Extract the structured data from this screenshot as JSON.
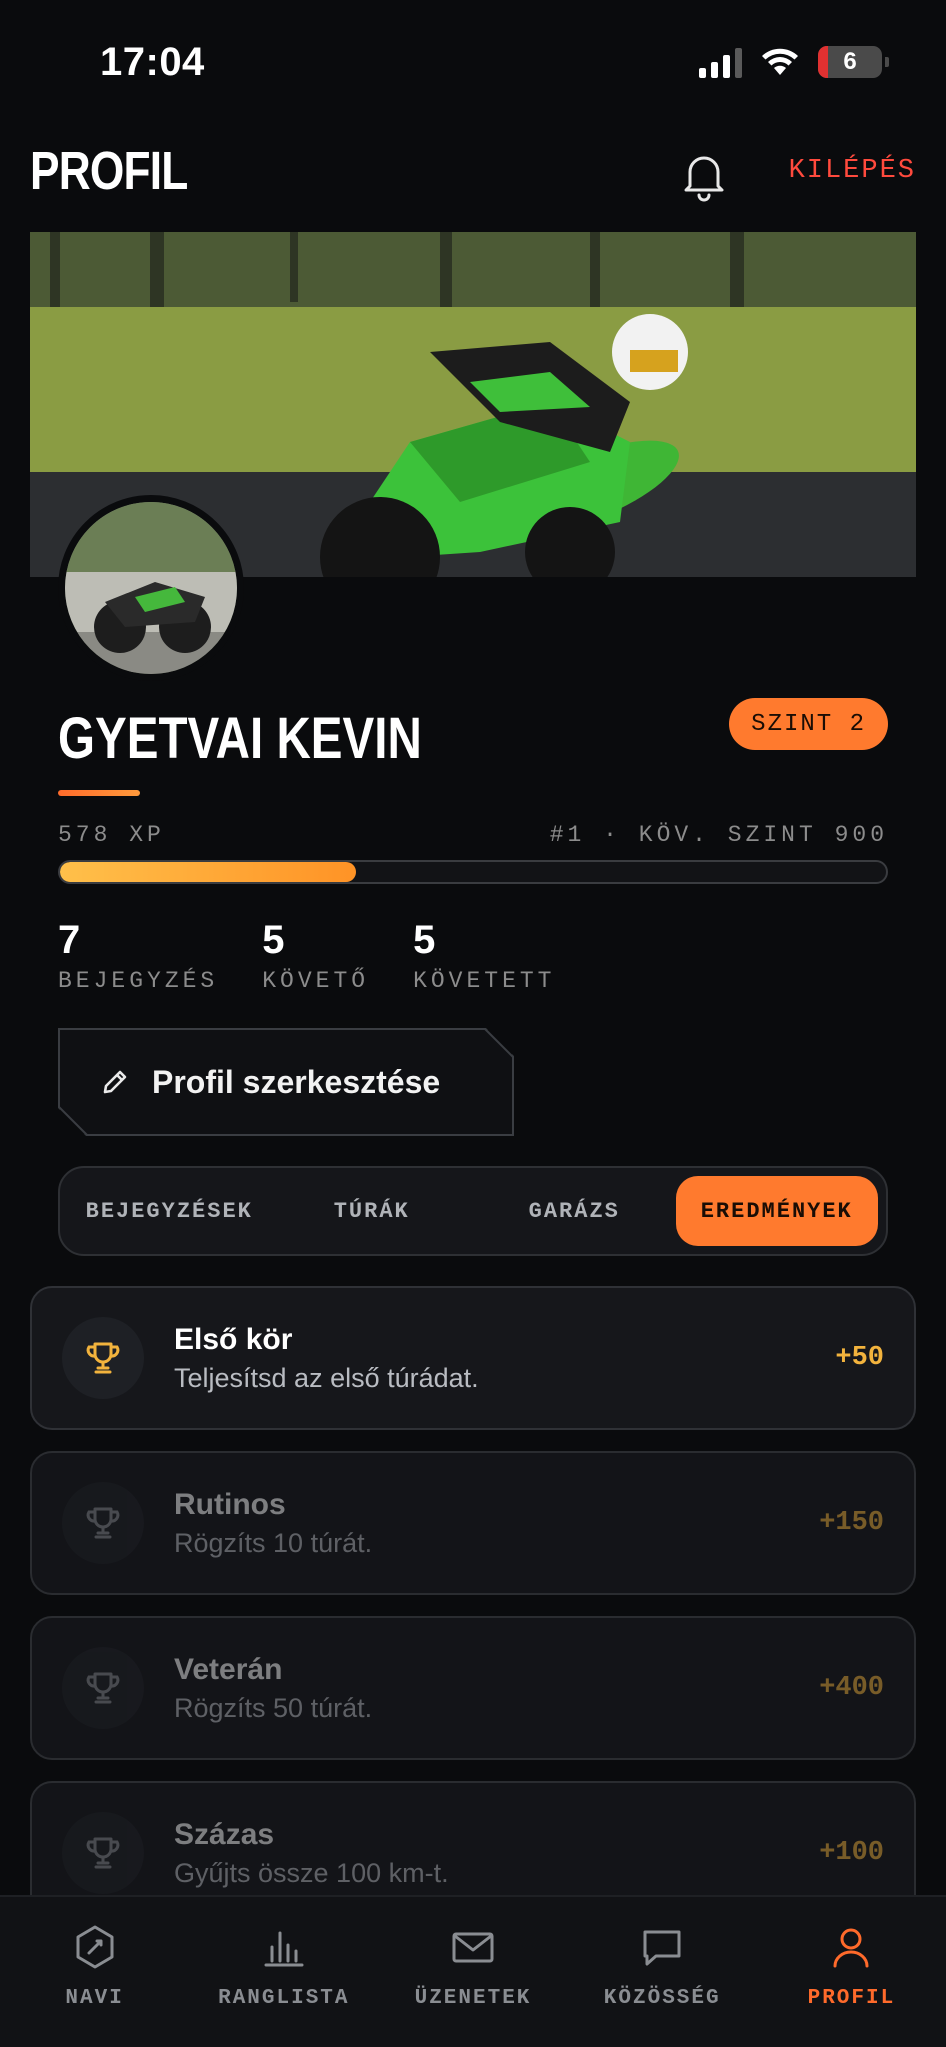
{
  "status_bar": {
    "time": "17:04",
    "battery": "6"
  },
  "header": {
    "title": "PROFIL",
    "logout_label": "KILÉPÉS"
  },
  "profile": {
    "name": "GYETVAI KEVIN",
    "level_badge": "SZINT 2",
    "xp_label": "578 XP",
    "rank_next": "#1 · KÖV. SZINT 900",
    "xp_progress": 0.358,
    "stats": [
      {
        "value": "7",
        "label": "BEJEGYZÉS"
      },
      {
        "value": "5",
        "label": "KÖVETŐ"
      },
      {
        "value": "5",
        "label": "KÖVETETT"
      }
    ],
    "edit_label": "Profil szerkesztése"
  },
  "tabs": [
    {
      "label": "BEJEGYZÉSEK",
      "active": false
    },
    {
      "label": "TÚRÁK",
      "active": false
    },
    {
      "label": "GARÁZS",
      "active": false
    },
    {
      "label": "EREDMÉNYEK",
      "active": true
    }
  ],
  "achievements": [
    {
      "title": "Első kör",
      "desc": "Teljesítsd az első túrádat.",
      "points": "+50",
      "unlocked": true,
      "icon": "trophy-icon"
    },
    {
      "title": "Rutinos",
      "desc": "Rögzíts 10 túrát.",
      "points": "+150",
      "unlocked": false,
      "icon": "trophy-icon"
    },
    {
      "title": "Veterán",
      "desc": "Rögzíts 50 túrát.",
      "points": "+400",
      "unlocked": false,
      "icon": "trophy-icon"
    },
    {
      "title": "Százas",
      "desc": "Gyűjts össze 100 km-t.",
      "points": "+100",
      "unlocked": false,
      "icon": "trophy-icon"
    }
  ],
  "bottom_nav": [
    {
      "label": "NAVI",
      "icon": "compass-hex-icon",
      "active": false
    },
    {
      "label": "RANGLISTA",
      "icon": "bar-chart-icon",
      "active": false
    },
    {
      "label": "ÜZENETEK",
      "icon": "mail-icon",
      "active": false
    },
    {
      "label": "KÖZÖSSÉG",
      "icon": "chat-bubble-icon",
      "active": false
    },
    {
      "label": "PROFIL",
      "icon": "user-icon",
      "active": true
    }
  ],
  "colors": {
    "accent": "#ff7a2e",
    "logout": "#ff4a3d",
    "points": "#f2b33d",
    "background": "#0a0b0d"
  }
}
